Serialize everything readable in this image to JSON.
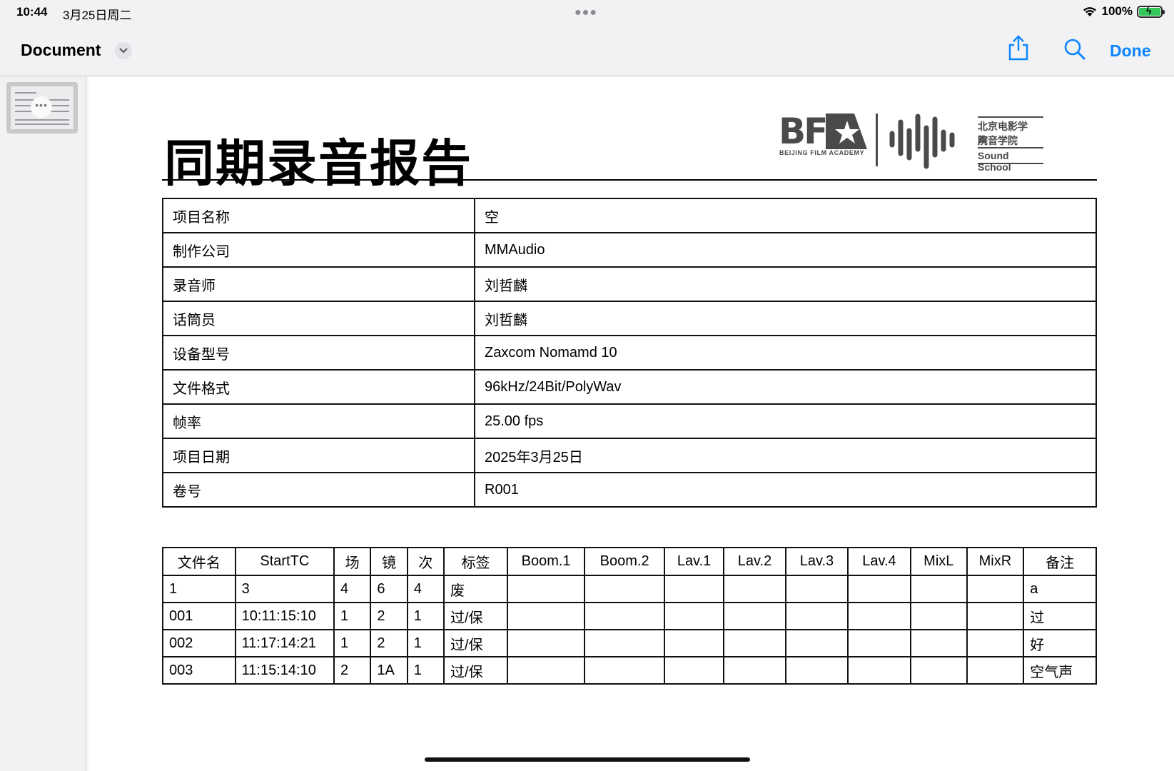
{
  "status": {
    "time": "10:44",
    "date": "3月25日周二",
    "battery": "100%"
  },
  "nav": {
    "title": "Document",
    "done": "Done"
  },
  "doc": {
    "title": "同期录音报告",
    "logo": {
      "bf": "BF",
      "academy": "BEIJING FILM ACADEMY",
      "line1": "北京电影学院",
      "line2": "声音学院",
      "line3": "Sound School"
    },
    "info": [
      {
        "k": "项目名称",
        "v": "空"
      },
      {
        "k": "制作公司",
        "v": "MMAudio"
      },
      {
        "k": "录音师",
        "v": "刘哲麟"
      },
      {
        "k": "话筒员",
        "v": "刘哲麟"
      },
      {
        "k": "设备型号",
        "v": "Zaxcom Nomamd 10"
      },
      {
        "k": "文件格式",
        "v": "96kHz/24Bit/PolyWav"
      },
      {
        "k": "帧率",
        "v": "25.00 fps"
      },
      {
        "k": "项目日期",
        "v": "2025年3月25日"
      },
      {
        "k": "卷号",
        "v": "R001"
      }
    ],
    "takes": {
      "headers": [
        "文件名",
        "StartTC",
        "场",
        "镜",
        "次",
        "标签",
        "Boom.1",
        "Boom.2",
        "Lav.1",
        "Lav.2",
        "Lav.3",
        "Lav.4",
        "MixL",
        "MixR",
        "备注"
      ],
      "rows": [
        [
          "1",
          "3",
          "4",
          "6",
          "4",
          "废",
          "",
          "",
          "",
          "",
          "",
          "",
          "",
          "",
          "a"
        ],
        [
          "001",
          "10:11:15:10",
          "1",
          "2",
          "1",
          "过/保",
          "",
          "",
          "",
          "",
          "",
          "",
          "",
          "",
          "过"
        ],
        [
          "002",
          "11:17:14:21",
          "1",
          "2",
          "1",
          "过/保",
          "",
          "",
          "",
          "",
          "",
          "",
          "",
          "",
          "好"
        ],
        [
          "003",
          "11:15:14:10",
          "2",
          "1A",
          "1",
          "过/保",
          "",
          "",
          "",
          "",
          "",
          "",
          "",
          "",
          "空气声"
        ]
      ]
    }
  }
}
